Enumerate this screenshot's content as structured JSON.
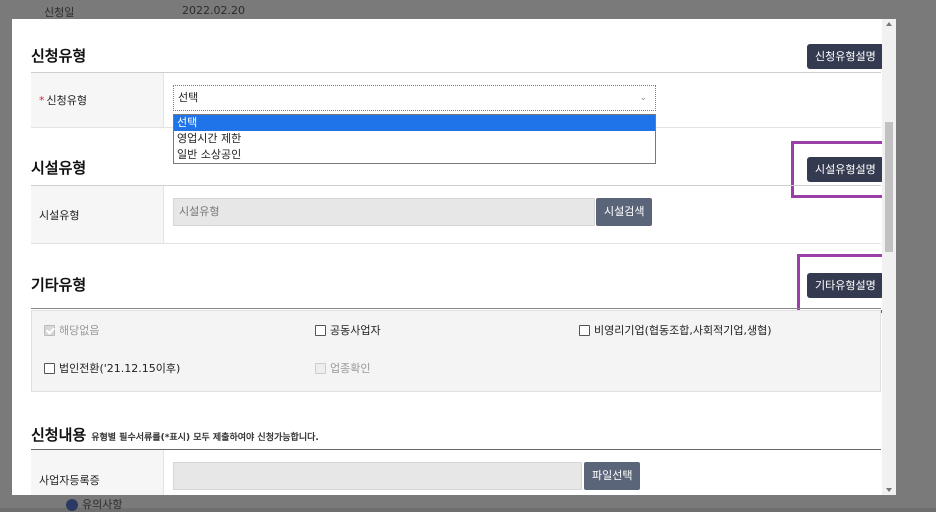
{
  "backdrop": {
    "top_label": "신청일",
    "top_value": "2022.02.20",
    "bottom_text": "유의사항"
  },
  "apply_type": {
    "title": "신청유형",
    "help_button": "신청유형설명",
    "field_label": "신청유형",
    "select_value": "선택",
    "options": [
      "선택",
      "영업시간 제한",
      "일반 소상공인"
    ]
  },
  "facility_type": {
    "title": "시설유형",
    "help_button": "시설유형설명",
    "field_label": "시설유형",
    "input_placeholder": "시설유형",
    "search_button": "시설검색"
  },
  "other_type": {
    "title": "기타유형",
    "help_button": "기타유형설명",
    "checkboxes": [
      {
        "label": "해당없음",
        "checked": true,
        "disabled": true
      },
      {
        "label": "공동사업자",
        "checked": false,
        "disabled": false
      },
      {
        "label": "비영리기업(협동조합,사회적기업,생협)",
        "checked": false,
        "disabled": false
      },
      {
        "label": "법인전환('21.12.15이후)",
        "checked": false,
        "disabled": false
      },
      {
        "label": "업종확인",
        "checked": false,
        "disabled": true
      }
    ]
  },
  "apply_content": {
    "title": "신청내용",
    "subtitle": "유형별 필수서류를(*표시) 모두 제출하여야 신청가능합니다.",
    "field_label": "사업자등록증",
    "file_button": "파일선택"
  },
  "colors": {
    "highlight": "#9b3fa8",
    "dark_button": "#343a4f",
    "selected_option": "#1e74e8",
    "required": "#e0203c"
  }
}
